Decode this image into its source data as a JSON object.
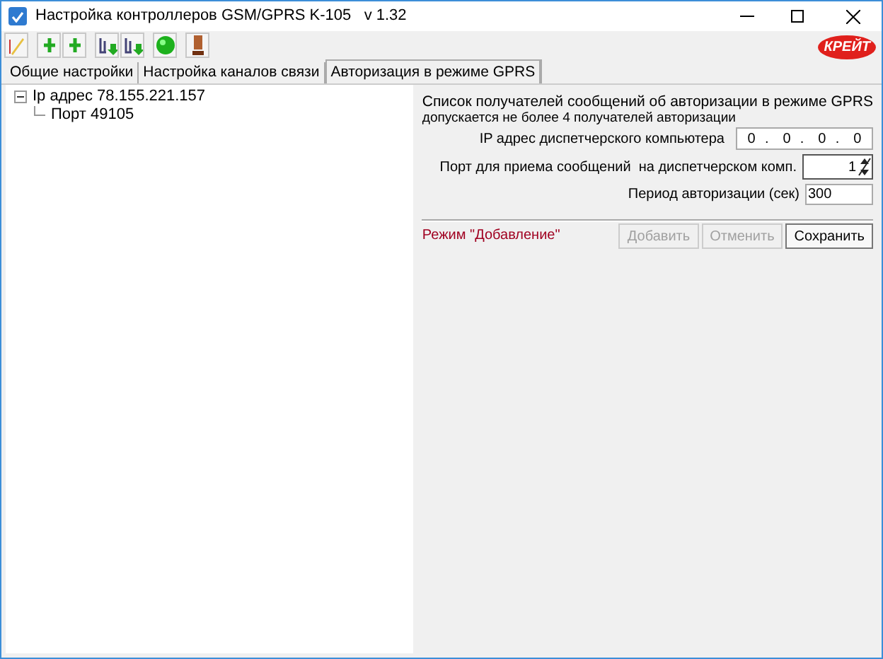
{
  "window": {
    "title": "Настройка контроллеров GSM/GPRS K-105   v 1.32"
  },
  "logo": "КРЕЙТ",
  "toolbar": [
    {
      "kind": "edit"
    },
    {
      "kind": "add",
      "disabled": false
    },
    {
      "kind": "add",
      "disabled": false
    },
    {
      "kind": "download"
    },
    {
      "kind": "download"
    },
    {
      "kind": "connect"
    },
    {
      "kind": "plug"
    }
  ],
  "tabs": [
    {
      "label": "Общие настройки",
      "selected": false
    },
    {
      "label": "Настройка каналов связи",
      "selected": false
    },
    {
      "label": "Авторизация в режиме GPRS",
      "selected": true
    }
  ],
  "tree": [
    {
      "label": "Ip адрес  78.155.221.157",
      "expanded": true,
      "children": [
        {
          "label": "Порт 49105"
        }
      ]
    }
  ],
  "form": {
    "heading": "Список получателей сообщений об авторизации в режиме GPRS",
    "note": "допускается не более 4 получателей авторизации",
    "ip_label": "IP адрес диспетчерского компьютера",
    "ip": [
      "0",
      "0",
      "0",
      "0"
    ],
    "ip_separator": ".",
    "port_label": "Порт для приема сообщений  на диспетчерском комп.",
    "port": "1",
    "period_label": "Период авторизации (сек)",
    "period": "300",
    "mode": "Режим \"Добавление\"",
    "buttons": [
      {
        "label": "Добавить",
        "disabled": true
      },
      {
        "label": "Отменить",
        "disabled": true
      },
      {
        "label": "Сохранить",
        "disabled": false
      }
    ]
  }
}
